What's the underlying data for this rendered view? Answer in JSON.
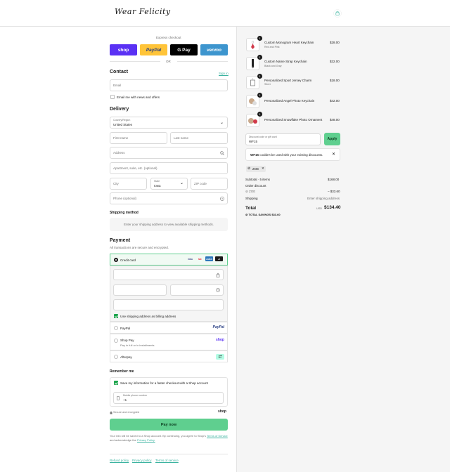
{
  "header": {
    "logo_text": "Wear Felicity",
    "cart_icon": "shopping-bag-icon"
  },
  "express": {
    "label": "Express checkout",
    "or_label": "OR",
    "buttons": [
      {
        "name": "shop",
        "label": "shop",
        "color": "#5a31f4"
      },
      {
        "name": "paypal",
        "label": "PayPal",
        "color": "#ffc439"
      },
      {
        "name": "gpay",
        "label": "G Pay",
        "color": "#000000"
      },
      {
        "name": "venmo",
        "label": "venmo",
        "color": "#3d95ce"
      }
    ]
  },
  "contact": {
    "title": "Contact",
    "sign_in": "Sign in",
    "email_placeholder": "Email",
    "news_label": "Email me with news and offers"
  },
  "delivery": {
    "title": "Delivery",
    "country_label": "Country/Region",
    "country_value": "United States",
    "first_name": "First name",
    "last_name": "Last name",
    "address": "Address",
    "apartment": "Apartment, suite, etc. (optional)",
    "city": "City",
    "state_label": "State",
    "state_value": "Iowa",
    "zip": "ZIP code",
    "phone": "Phone (optional)"
  },
  "shipping": {
    "title": "Shipping method",
    "message": "Enter your shipping address to view available shipping methods."
  },
  "payment": {
    "title": "Payment",
    "subtitle": "All transactions are secure and encrypted.",
    "credit_card": "Credit card",
    "card_badges": [
      "VISA",
      "MC",
      "AMEX",
      "+5"
    ],
    "billing_label": "Use shipping address as billing address",
    "paypal": "PayPal",
    "paypal_logo": "PayPal",
    "shoppay": "Shop Pay",
    "shoppay_sub": "Pay in full or in installments",
    "shoppay_logo": "shop",
    "afterpay": "Afterpay"
  },
  "remember": {
    "title": "Remember me",
    "save_label": "Save my information for a faster checkout with a Shop account",
    "phone_label": "Mobile phone number",
    "phone_value": "+1",
    "secure": "Secure and encrypted",
    "shop_logo": "shop"
  },
  "pay_now": "Pay now",
  "legal": {
    "text1": "Your info will be saved to a Shop account. By continuing, you agree to Shop's",
    "tos": "Terms of Service",
    "text2": "and acknowledge the",
    "privacy": "Privacy Policy."
  },
  "footer_links": [
    "Refund policy",
    "Privacy policy",
    "Terms of service"
  ],
  "accent": "#5fcf8f",
  "summary": {
    "items": [
      {
        "qty": "1",
        "name": "Custom Monogram Heart Keychain",
        "variant": "Red and Pink",
        "price": "$28.00"
      },
      {
        "qty": "1",
        "name": "Custom Name Strap Keychain",
        "variant": "Black and Gray",
        "price": "$32.00"
      },
      {
        "qty": "1",
        "name": "Personalized Sport Jersey Charm",
        "variant": "Silver",
        "price": "$18.00"
      },
      {
        "qty": "1",
        "name": "Personalized Angel Photo Keychain",
        "variant": "",
        "price": "$42.00"
      },
      {
        "qty": "1",
        "name": "Personalized Snowflake Photo Ornament",
        "variant": "",
        "price": "$48.00"
      }
    ],
    "discount_label": "Discount code or gift card",
    "discount_value": "WF15",
    "apply": "Apply",
    "error_code": "WF15",
    "error_text": "couldn't be used with your existing discounts.",
    "tag": "ZOE",
    "subtotal_label": "Subtotal · 5 items",
    "subtotal": "$168.00",
    "order_discount": "Order discount",
    "discount_tag": "ZOE",
    "discount_amount": "– $33.60",
    "shipping_label": "Shipping",
    "shipping_value": "Enter shipping address",
    "total_label": "Total",
    "currency": "USD",
    "total": "$134.40",
    "savings_label": "TOTAL SAVINGS",
    "savings": "$33.60"
  }
}
